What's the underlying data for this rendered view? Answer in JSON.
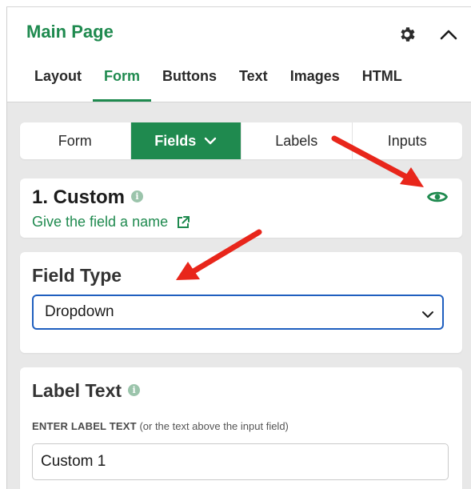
{
  "panel": {
    "title": "Main Page",
    "icons": {
      "settings": "gear-icon",
      "collapse": "chevron-up-icon"
    }
  },
  "main_tabs": [
    {
      "label": "Layout",
      "active": false
    },
    {
      "label": "Form",
      "active": true
    },
    {
      "label": "Buttons",
      "active": false
    },
    {
      "label": "Text",
      "active": false
    },
    {
      "label": "Images",
      "active": false
    },
    {
      "label": "HTML",
      "active": false
    }
  ],
  "sub_tabs": [
    {
      "label": "Form",
      "active": false
    },
    {
      "label": "Fields",
      "active": true,
      "has_dropdown": true
    },
    {
      "label": "Labels",
      "active": false
    },
    {
      "label": "Inputs",
      "active": false
    }
  ],
  "field_card": {
    "heading": "1. Custom",
    "name_link": "Give the field a name",
    "icons": {
      "info": "info-icon",
      "visibility": "eye-icon",
      "external": "external-link-icon"
    }
  },
  "field_type": {
    "heading": "Field Type",
    "selected": "Dropdown"
  },
  "label_text": {
    "heading": "Label Text",
    "caption_strong": "ENTER LABEL TEXT",
    "caption_rest": "(or the text above the input field)",
    "value": "Custom 1"
  },
  "colors": {
    "accent": "#1f8a4f",
    "focus_border": "#1f5fbf",
    "annotation_arrow": "#e8261b",
    "panel_bg": "#e8e8e8"
  }
}
